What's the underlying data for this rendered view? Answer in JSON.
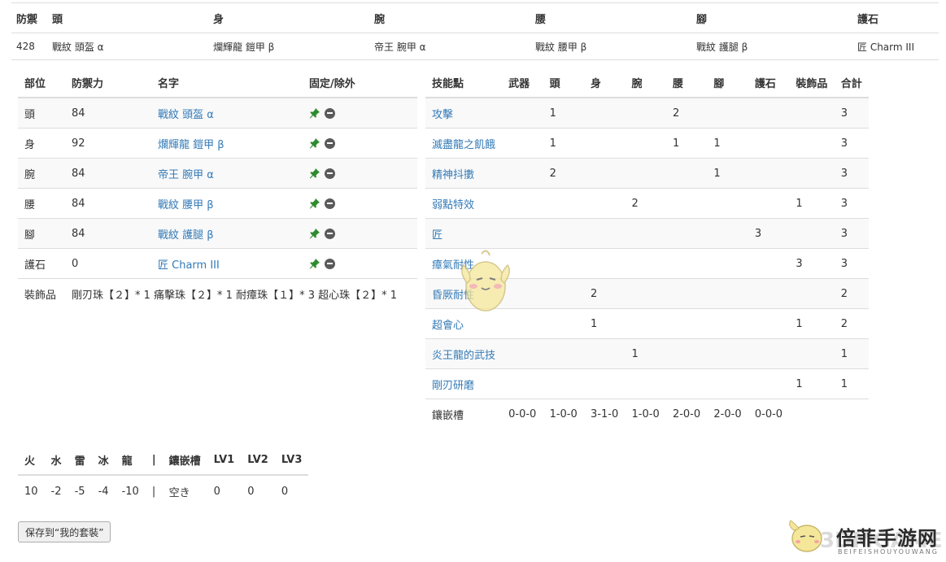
{
  "summary": {
    "headers": [
      "防禦",
      "頭",
      "身",
      "腕",
      "腰",
      "腳",
      "護石"
    ],
    "values": [
      "428",
      "戰紋 頭盔 α",
      "爛輝龍 鎧甲 β",
      "帝王 腕甲 α",
      "戰紋 腰甲 β",
      "戰紋 護腿 β",
      "匠 Charm III"
    ]
  },
  "equipment": {
    "headers": [
      "部位",
      "防禦力",
      "名字",
      "固定/除外"
    ],
    "rows": [
      {
        "part": "頭",
        "def": "84",
        "name": "戰紋 頭盔 α"
      },
      {
        "part": "身",
        "def": "92",
        "name": "爛輝龍 鎧甲 β"
      },
      {
        "part": "腕",
        "def": "84",
        "name": "帝王 腕甲 α"
      },
      {
        "part": "腰",
        "def": "84",
        "name": "戰紋 腰甲 β"
      },
      {
        "part": "腳",
        "def": "84",
        "name": "戰紋 護腿 β"
      },
      {
        "part": "護石",
        "def": "0",
        "name": "匠 Charm III"
      }
    ],
    "deco_label": "裝飾品",
    "deco_value": "剛刃珠【２】* 1 痛擊珠【２】* 1 耐瘴珠【１】* 3 超心珠【２】* 1"
  },
  "skills": {
    "headers": [
      "技能點",
      "武器",
      "頭",
      "身",
      "腕",
      "腰",
      "腳",
      "護石",
      "裝飾品",
      "合計"
    ],
    "rows": [
      [
        "攻擊",
        "",
        "1",
        "",
        "",
        "2",
        "",
        "",
        "",
        "3"
      ],
      [
        "滅盡龍之飢餓",
        "",
        "1",
        "",
        "",
        "1",
        "1",
        "",
        "",
        "3"
      ],
      [
        "精神抖擻",
        "",
        "2",
        "",
        "",
        "",
        "1",
        "",
        "",
        "3"
      ],
      [
        "弱點特效",
        "",
        "",
        "",
        "2",
        "",
        "",
        "",
        "1",
        "3"
      ],
      [
        "匠",
        "",
        "",
        "",
        "",
        "",
        "",
        "3",
        "",
        "3"
      ],
      [
        "瘴氣耐性",
        "",
        "",
        "",
        "",
        "",
        "",
        "",
        "3",
        "3"
      ],
      [
        "昏厥耐性",
        "",
        "",
        "2",
        "",
        "",
        "",
        "",
        "",
        "2"
      ],
      [
        "超會心",
        "",
        "",
        "1",
        "",
        "",
        "",
        "",
        "1",
        "2"
      ],
      [
        "炎王龍的武技",
        "",
        "",
        "",
        "1",
        "",
        "",
        "",
        "",
        "1"
      ],
      [
        "剛刃研磨",
        "",
        "",
        "",
        "",
        "",
        "",
        "",
        "1",
        "1"
      ]
    ],
    "slot_label": "鑲嵌槽",
    "slots": [
      "0-0-0",
      "1-0-0",
      "3-1-0",
      "1-0-0",
      "2-0-0",
      "2-0-0",
      "0-0-0"
    ]
  },
  "resist": {
    "headers": [
      "火",
      "水",
      "雷",
      "冰",
      "龍",
      "|",
      "鑲嵌槽",
      "LV1",
      "LV2",
      "LV3"
    ],
    "values": [
      "10",
      "-2",
      "-5",
      "-4",
      "-10",
      "|",
      "空き",
      "0",
      "0",
      "0"
    ]
  },
  "save_button": "保存到“我的套裝”",
  "watermark": {
    "title": "倍菲手游网",
    "sub": "BEIFEISHOUYOUWANG",
    "logo": "3DMGAME"
  },
  "colors": {
    "link": "#337ab7",
    "pin": "#2e8b2e",
    "stripe": "#f9f9f9",
    "border": "#dddddd"
  }
}
